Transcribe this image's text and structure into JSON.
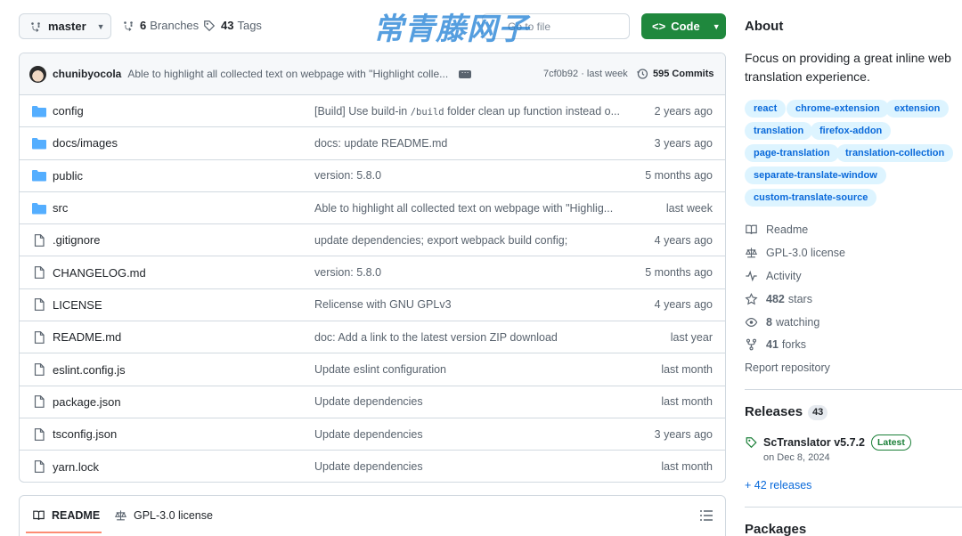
{
  "toolbar": {
    "branch": "master",
    "branches_count": "6",
    "branches_label": "Branches",
    "tags_count": "43",
    "tags_label": "Tags",
    "go_to_file": "Go to file",
    "watermark": "常青藤网子",
    "code_label": "Code"
  },
  "commit": {
    "author": "chunibyocola",
    "message": "Able to highlight all collected text on webpage with \"Highlight colle...",
    "hash": "7cf0b92 · last week",
    "count": "595 Commits"
  },
  "files": [
    {
      "type": "dir",
      "name": "config",
      "message_pre": "[Build] Use build-in ",
      "message_code": "/build",
      "message_post": " folder clean up function instead o...",
      "age": "2 years ago"
    },
    {
      "type": "dir",
      "name": "docs/images",
      "message_pre": "docs: update README.md",
      "message_code": "",
      "message_post": "",
      "age": "3 years ago"
    },
    {
      "type": "dir",
      "name": "public",
      "message_pre": "version: 5.8.0",
      "message_code": "",
      "message_post": "",
      "age": "5 months ago"
    },
    {
      "type": "dir",
      "name": "src",
      "message_pre": "Able to highlight all collected text on webpage with \"Highlig...",
      "message_code": "",
      "message_post": "",
      "age": "last week"
    },
    {
      "type": "file",
      "name": ".gitignore",
      "message_pre": "update dependencies; export webpack build config;",
      "message_code": "",
      "message_post": "",
      "age": "4 years ago"
    },
    {
      "type": "file",
      "name": "CHANGELOG.md",
      "message_pre": "version: 5.8.0",
      "message_code": "",
      "message_post": "",
      "age": "5 months ago"
    },
    {
      "type": "file",
      "name": "LICENSE",
      "message_pre": "Relicense with GNU GPLv3",
      "message_code": "",
      "message_post": "",
      "age": "4 years ago"
    },
    {
      "type": "file",
      "name": "README.md",
      "message_pre": "doc: Add a link to the latest version ZIP download",
      "message_code": "",
      "message_post": "",
      "age": "last year"
    },
    {
      "type": "file",
      "name": "eslint.config.js",
      "message_pre": "Update eslint configuration",
      "message_code": "",
      "message_post": "",
      "age": "last month"
    },
    {
      "type": "file",
      "name": "package.json",
      "message_pre": "Update dependencies",
      "message_code": "",
      "message_post": "",
      "age": "last month"
    },
    {
      "type": "file",
      "name": "tsconfig.json",
      "message_pre": "Update dependencies",
      "message_code": "",
      "message_post": "",
      "age": "3 years ago"
    },
    {
      "type": "file",
      "name": "yarn.lock",
      "message_pre": "Update dependencies",
      "message_code": "",
      "message_post": "",
      "age": "last month"
    }
  ],
  "readme_tabs": {
    "readme": "README",
    "license": "GPL-3.0 license"
  },
  "about": {
    "heading": "About",
    "description": "Focus on providing a great inline web translation experience.",
    "topics": [
      "react",
      "chrome-extension",
      "extension",
      "translation",
      "firefox-addon",
      "page-translation",
      "translation-collection",
      "separate-translate-window",
      "custom-translate-source"
    ],
    "readme": "Readme",
    "license": "GPL-3.0 license",
    "activity": "Activity",
    "stars_count": "482",
    "stars_label": "stars",
    "watching_count": "8",
    "watching_label": "watching",
    "forks_count": "41",
    "forks_label": "forks",
    "report": "Report repository"
  },
  "releases": {
    "heading": "Releases",
    "count": "43",
    "latest_name": "ScTranslator v5.7.2",
    "latest_badge": "Latest",
    "latest_date": "on Dec 8, 2024",
    "more": "+ 42 releases"
  },
  "packages": {
    "heading": "Packages"
  },
  "colors": {
    "accent": "#0969da",
    "code_button": "#1f883d",
    "folder": "#54aeff",
    "latest": "#1a7f37"
  }
}
